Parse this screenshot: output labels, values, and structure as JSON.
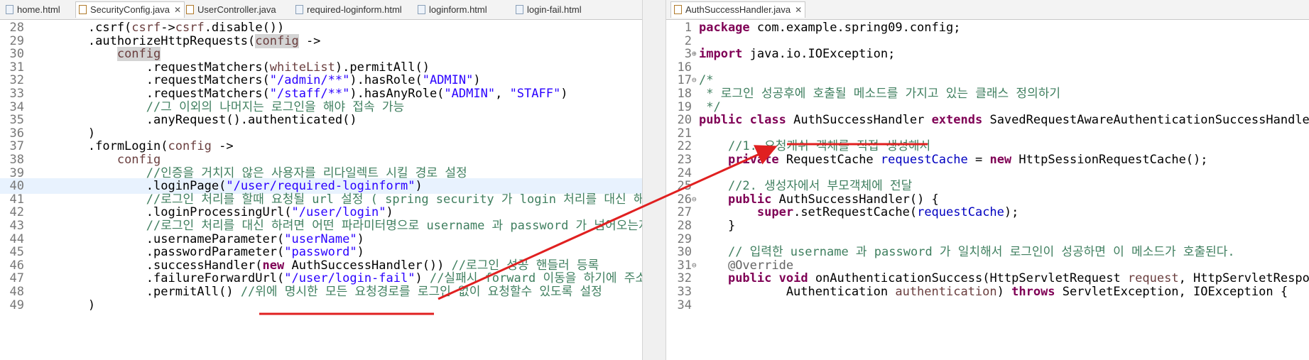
{
  "left_tabs": [
    {
      "label": "home.html",
      "icon": "html-file-icon",
      "active": false
    },
    {
      "label": "SecurityConfig.java",
      "icon": "java-file-icon",
      "active": true
    },
    {
      "label": "UserController.java",
      "icon": "java-file-icon",
      "active": false
    },
    {
      "label": "required-loginform.html",
      "icon": "html-file-icon",
      "active": false
    },
    {
      "label": "loginform.html",
      "icon": "html-file-icon",
      "active": false
    },
    {
      "label": "login-fail.html",
      "icon": "html-file-icon",
      "active": false
    }
  ],
  "close_glyph": "✕",
  "right_tabs": [
    {
      "label": "AuthSuccessHandler.java",
      "icon": "java-file-icon",
      "active": true
    }
  ],
  "left_code": [
    {
      "n": "28",
      "s": [
        [
          "",
          "        .csrf("
        ],
        [
          "prm",
          "csrf"
        ],
        [
          "",
          "->"
        ],
        [
          "prm",
          "csrf"
        ],
        [
          "",
          ".disable())"
        ]
      ]
    },
    {
      "n": "29",
      "s": [
        [
          "",
          "        .authorizeHttpRequests("
        ],
        [
          "prm occ",
          "config"
        ],
        [
          "",
          " ->"
        ]
      ]
    },
    {
      "n": "30",
      "s": [
        [
          "",
          "            "
        ],
        [
          "prm occ",
          "config"
        ]
      ]
    },
    {
      "n": "31",
      "s": [
        [
          "",
          "                .requestMatchers("
        ],
        [
          "prm",
          "whiteList"
        ],
        [
          "",
          ").permitAll()"
        ]
      ]
    },
    {
      "n": "32",
      "s": [
        [
          "",
          "                .requestMatchers("
        ],
        [
          "str",
          "\"/admin/**\""
        ],
        [
          "",
          ").hasRole("
        ],
        [
          "str",
          "\"ADMIN\""
        ],
        [
          "",
          ")"
        ]
      ]
    },
    {
      "n": "33",
      "s": [
        [
          "",
          "                .requestMatchers("
        ],
        [
          "str",
          "\"/staff/**\""
        ],
        [
          "",
          ").hasAnyRole("
        ],
        [
          "str",
          "\"ADMIN\""
        ],
        [
          "",
          ", "
        ],
        [
          "str",
          "\"STAFF\""
        ],
        [
          "",
          ")"
        ]
      ]
    },
    {
      "n": "34",
      "s": [
        [
          "",
          "                "
        ],
        [
          "cm",
          "//그 이외의 나머지는 로그인을 해야 접속 가능"
        ]
      ]
    },
    {
      "n": "35",
      "s": [
        [
          "",
          "                .anyRequest().authenticated()"
        ]
      ]
    },
    {
      "n": "36",
      "s": [
        [
          "",
          "        )"
        ]
      ]
    },
    {
      "n": "37",
      "s": [
        [
          "",
          "        .formLogin("
        ],
        [
          "prm",
          "config"
        ],
        [
          "",
          " ->"
        ]
      ]
    },
    {
      "n": "38",
      "s": [
        [
          "",
          "            "
        ],
        [
          "prm",
          "config"
        ]
      ]
    },
    {
      "n": "39",
      "s": [
        [
          "",
          "                "
        ],
        [
          "cm",
          "//인증을 거치지 않은 사용자를 리다일렉트 시킬 경로 설정"
        ]
      ]
    },
    {
      "n": "40",
      "hl": true,
      "s": [
        [
          "",
          "                .loginPage("
        ],
        [
          "str",
          "\"/user/required-loginform\""
        ],
        [
          "",
          ")"
        ]
      ]
    },
    {
      "n": "41",
      "s": [
        [
          "",
          "                "
        ],
        [
          "cm",
          "//로그인 처리를 할때 요청될 url 설정 ( spring security 가 login 처리를 대신 해준다 )"
        ]
      ]
    },
    {
      "n": "42",
      "s": [
        [
          "",
          "                .loginProcessingUrl("
        ],
        [
          "str",
          "\"/user/login\""
        ],
        [
          "",
          ")"
        ]
      ]
    },
    {
      "n": "43",
      "s": [
        [
          "",
          "                "
        ],
        [
          "cm",
          "//로그인 처리를 대신 하려면 어떤 파라미터명으로 username 과 password 가 넘어오는지 알려준다"
        ]
      ]
    },
    {
      "n": "44",
      "s": [
        [
          "",
          "                .usernameParameter("
        ],
        [
          "str",
          "\"userName\""
        ],
        [
          "",
          ")"
        ]
      ]
    },
    {
      "n": "45",
      "s": [
        [
          "",
          "                .passwordParameter("
        ],
        [
          "str",
          "\"password\""
        ],
        [
          "",
          ")"
        ]
      ]
    },
    {
      "n": "46",
      "s": [
        [
          "",
          "                .successHandler("
        ],
        [
          "kw",
          "new"
        ],
        [
          "",
          " AuthSuccessHandler()) "
        ],
        [
          "cm",
          "//로그인 성공 핸들러 등록"
        ]
      ]
    },
    {
      "n": "47",
      "s": [
        [
          "",
          "                .failureForwardUrl("
        ],
        [
          "str",
          "\"/user/login-fail\""
        ],
        [
          "",
          ") "
        ],
        [
          "cm",
          "//실패시 forward 이동을 하기에 주소창은 그대로"
        ]
      ]
    },
    {
      "n": "48",
      "s": [
        [
          "",
          "                .permitAll() "
        ],
        [
          "cm",
          "//위에 명시한 모든 요청경로를 로그인 없이 요청할수 있도록 설정"
        ]
      ]
    },
    {
      "n": "49",
      "s": [
        [
          "",
          "        )"
        ]
      ]
    }
  ],
  "right_code": [
    {
      "n": "1",
      "s": [
        [
          "kw",
          "package"
        ],
        [
          "",
          " com.example.spring09.config;"
        ]
      ]
    },
    {
      "n": "2",
      "s": []
    },
    {
      "n": "3",
      "fold": "⊕",
      "s": [
        [
          "kw",
          "import"
        ],
        [
          "",
          " java.io.IOException;"
        ]
      ]
    },
    {
      "n": "16",
      "s": []
    },
    {
      "n": "17",
      "fold": "⊖",
      "s": [
        [
          "cm",
          "/*"
        ]
      ]
    },
    {
      "n": "18",
      "s": [
        [
          "cm",
          " * 로그인 성공후에 호출될 메소드를 가지고 있는 클래스 정의하기"
        ]
      ]
    },
    {
      "n": "19",
      "s": [
        [
          "cm",
          " */"
        ]
      ]
    },
    {
      "n": "20",
      "s": [
        [
          "kw",
          "public"
        ],
        [
          "",
          " "
        ],
        [
          "kw",
          "class"
        ],
        [
          "",
          " AuthSuccessHandler "
        ],
        [
          "kw",
          "extends"
        ],
        [
          "",
          " SavedRequestAwareAuthenticationSuccessHandler{"
        ]
      ]
    },
    {
      "n": "21",
      "s": []
    },
    {
      "n": "22",
      "s": [
        [
          "",
          "    "
        ],
        [
          "cm",
          "//1. 요청캐쉬 객체를 직접 생성해서"
        ]
      ]
    },
    {
      "n": "23",
      "s": [
        [
          "",
          "    "
        ],
        [
          "kw",
          "private"
        ],
        [
          "",
          " RequestCache "
        ],
        [
          "fld",
          "requestCache"
        ],
        [
          "",
          " = "
        ],
        [
          "kw",
          "new"
        ],
        [
          "",
          " HttpSessionRequestCache();"
        ]
      ]
    },
    {
      "n": "24",
      "s": []
    },
    {
      "n": "25",
      "s": [
        [
          "",
          "    "
        ],
        [
          "cm",
          "//2. 생성자에서 부모객체에 전달"
        ]
      ]
    },
    {
      "n": "26",
      "fold": "⊖",
      "s": [
        [
          "",
          "    "
        ],
        [
          "kw",
          "public"
        ],
        [
          "",
          " AuthSuccessHandler() {"
        ]
      ]
    },
    {
      "n": "27",
      "s": [
        [
          "",
          "        "
        ],
        [
          "kw",
          "super"
        ],
        [
          "",
          ".setRequestCache("
        ],
        [
          "fld",
          "requestCache"
        ],
        [
          "",
          ");"
        ]
      ]
    },
    {
      "n": "28",
      "s": [
        [
          "",
          "    }"
        ]
      ]
    },
    {
      "n": "29",
      "s": []
    },
    {
      "n": "30",
      "s": [
        [
          "",
          "    "
        ],
        [
          "cm",
          "// 입력한 username 과 password 가 일치해서 로그인이 성공하면 이 메소드가 호출된다."
        ]
      ]
    },
    {
      "n": "31",
      "fold": "⊖",
      "s": [
        [
          "",
          "    "
        ],
        [
          "ann",
          "@Override"
        ]
      ]
    },
    {
      "n": "32",
      "s": [
        [
          "",
          "    "
        ],
        [
          "kw",
          "public"
        ],
        [
          "",
          " "
        ],
        [
          "kw",
          "void"
        ],
        [
          "",
          " onAuthenticationSuccess(HttpServletRequest "
        ],
        [
          "prm",
          "request"
        ],
        [
          "",
          ", HttpServletResponse "
        ],
        [
          "prm",
          "response"
        ],
        [
          "",
          ","
        ]
      ]
    },
    {
      "n": "33",
      "s": [
        [
          "",
          "            Authentication "
        ],
        [
          "prm",
          "authentication"
        ],
        [
          "",
          ") "
        ],
        [
          "kw",
          "throws"
        ],
        [
          "",
          " ServletException, IOException {"
        ]
      ]
    },
    {
      "n": "34",
      "s": []
    }
  ],
  "accent_colors": {
    "keyword": "#7f0055",
    "string": "#2a00ff",
    "comment": "#3f7f5f",
    "annotation_marker": "#e02020"
  }
}
